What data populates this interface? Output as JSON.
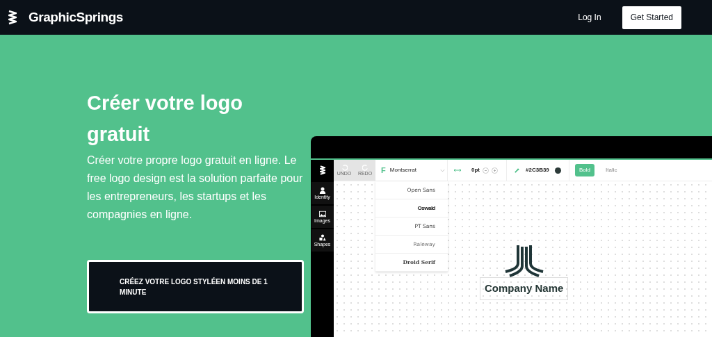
{
  "header": {
    "brand": "GraphicSprings",
    "login": "Log In",
    "cta": "Get Started"
  },
  "hero": {
    "title": "Créer votre logo gratuit",
    "text": "Créer votre propre logo gratuit en ligne. Le free logo design est la solution parfaite pour les entrepreneurs, les startups et les compagnies en ligne.",
    "button": "CRÉEZ VOTRE LOGO STYLÉEN MOINS DE 1 MINUTE"
  },
  "editor": {
    "sidebar": [
      {
        "kind": "person",
        "label": "Identity"
      },
      {
        "kind": "image",
        "label": "Images"
      },
      {
        "kind": "shapes",
        "label": "Shapes"
      }
    ],
    "undo": "UNDO",
    "redo": "REDO",
    "font_letter": "F",
    "font": "Montserrat",
    "spacing": "0pt",
    "color_value": "#2C3B39",
    "color": "#2c3b39",
    "styles": [
      {
        "label": "Bold",
        "selected": true
      },
      {
        "label": "Italic",
        "selected": false
      }
    ],
    "fonts": [
      {
        "label": "Open Sans",
        "kind": "sans"
      },
      {
        "label": "Oswald",
        "kind": "condensed"
      },
      {
        "label": "PT Sans",
        "kind": "sans"
      },
      {
        "label": "Raleway",
        "kind": "light"
      },
      {
        "label": "Droid Serif",
        "kind": "serif"
      }
    ],
    "company": "Company Name"
  }
}
